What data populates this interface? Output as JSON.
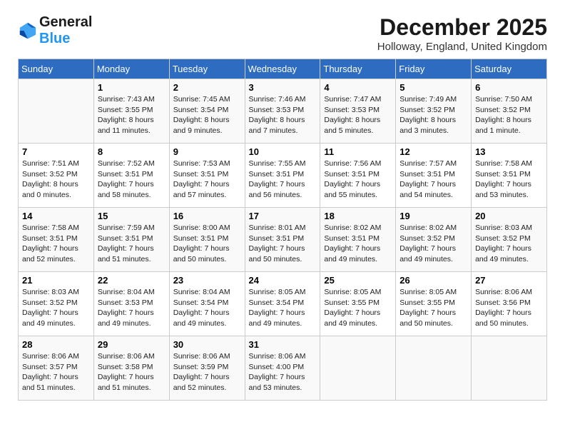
{
  "header": {
    "logo_general": "General",
    "logo_blue": "Blue",
    "month_year": "December 2025",
    "location": "Holloway, England, United Kingdom"
  },
  "weekdays": [
    "Sunday",
    "Monday",
    "Tuesday",
    "Wednesday",
    "Thursday",
    "Friday",
    "Saturday"
  ],
  "weeks": [
    [
      {
        "day": "",
        "info": ""
      },
      {
        "day": "1",
        "info": "Sunrise: 7:43 AM\nSunset: 3:55 PM\nDaylight: 8 hours\nand 11 minutes."
      },
      {
        "day": "2",
        "info": "Sunrise: 7:45 AM\nSunset: 3:54 PM\nDaylight: 8 hours\nand 9 minutes."
      },
      {
        "day": "3",
        "info": "Sunrise: 7:46 AM\nSunset: 3:53 PM\nDaylight: 8 hours\nand 7 minutes."
      },
      {
        "day": "4",
        "info": "Sunrise: 7:47 AM\nSunset: 3:53 PM\nDaylight: 8 hours\nand 5 minutes."
      },
      {
        "day": "5",
        "info": "Sunrise: 7:49 AM\nSunset: 3:52 PM\nDaylight: 8 hours\nand 3 minutes."
      },
      {
        "day": "6",
        "info": "Sunrise: 7:50 AM\nSunset: 3:52 PM\nDaylight: 8 hours\nand 1 minute."
      }
    ],
    [
      {
        "day": "7",
        "info": "Sunrise: 7:51 AM\nSunset: 3:52 PM\nDaylight: 8 hours\nand 0 minutes."
      },
      {
        "day": "8",
        "info": "Sunrise: 7:52 AM\nSunset: 3:51 PM\nDaylight: 7 hours\nand 58 minutes."
      },
      {
        "day": "9",
        "info": "Sunrise: 7:53 AM\nSunset: 3:51 PM\nDaylight: 7 hours\nand 57 minutes."
      },
      {
        "day": "10",
        "info": "Sunrise: 7:55 AM\nSunset: 3:51 PM\nDaylight: 7 hours\nand 56 minutes."
      },
      {
        "day": "11",
        "info": "Sunrise: 7:56 AM\nSunset: 3:51 PM\nDaylight: 7 hours\nand 55 minutes."
      },
      {
        "day": "12",
        "info": "Sunrise: 7:57 AM\nSunset: 3:51 PM\nDaylight: 7 hours\nand 54 minutes."
      },
      {
        "day": "13",
        "info": "Sunrise: 7:58 AM\nSunset: 3:51 PM\nDaylight: 7 hours\nand 53 minutes."
      }
    ],
    [
      {
        "day": "14",
        "info": "Sunrise: 7:58 AM\nSunset: 3:51 PM\nDaylight: 7 hours\nand 52 minutes."
      },
      {
        "day": "15",
        "info": "Sunrise: 7:59 AM\nSunset: 3:51 PM\nDaylight: 7 hours\nand 51 minutes."
      },
      {
        "day": "16",
        "info": "Sunrise: 8:00 AM\nSunset: 3:51 PM\nDaylight: 7 hours\nand 50 minutes."
      },
      {
        "day": "17",
        "info": "Sunrise: 8:01 AM\nSunset: 3:51 PM\nDaylight: 7 hours\nand 50 minutes."
      },
      {
        "day": "18",
        "info": "Sunrise: 8:02 AM\nSunset: 3:51 PM\nDaylight: 7 hours\nand 49 minutes."
      },
      {
        "day": "19",
        "info": "Sunrise: 8:02 AM\nSunset: 3:52 PM\nDaylight: 7 hours\nand 49 minutes."
      },
      {
        "day": "20",
        "info": "Sunrise: 8:03 AM\nSunset: 3:52 PM\nDaylight: 7 hours\nand 49 minutes."
      }
    ],
    [
      {
        "day": "21",
        "info": "Sunrise: 8:03 AM\nSunset: 3:52 PM\nDaylight: 7 hours\nand 49 minutes."
      },
      {
        "day": "22",
        "info": "Sunrise: 8:04 AM\nSunset: 3:53 PM\nDaylight: 7 hours\nand 49 minutes."
      },
      {
        "day": "23",
        "info": "Sunrise: 8:04 AM\nSunset: 3:54 PM\nDaylight: 7 hours\nand 49 minutes."
      },
      {
        "day": "24",
        "info": "Sunrise: 8:05 AM\nSunset: 3:54 PM\nDaylight: 7 hours\nand 49 minutes."
      },
      {
        "day": "25",
        "info": "Sunrise: 8:05 AM\nSunset: 3:55 PM\nDaylight: 7 hours\nand 49 minutes."
      },
      {
        "day": "26",
        "info": "Sunrise: 8:05 AM\nSunset: 3:55 PM\nDaylight: 7 hours\nand 50 minutes."
      },
      {
        "day": "27",
        "info": "Sunrise: 8:06 AM\nSunset: 3:56 PM\nDaylight: 7 hours\nand 50 minutes."
      }
    ],
    [
      {
        "day": "28",
        "info": "Sunrise: 8:06 AM\nSunset: 3:57 PM\nDaylight: 7 hours\nand 51 minutes."
      },
      {
        "day": "29",
        "info": "Sunrise: 8:06 AM\nSunset: 3:58 PM\nDaylight: 7 hours\nand 51 minutes."
      },
      {
        "day": "30",
        "info": "Sunrise: 8:06 AM\nSunset: 3:59 PM\nDaylight: 7 hours\nand 52 minutes."
      },
      {
        "day": "31",
        "info": "Sunrise: 8:06 AM\nSunset: 4:00 PM\nDaylight: 7 hours\nand 53 minutes."
      },
      {
        "day": "",
        "info": ""
      },
      {
        "day": "",
        "info": ""
      },
      {
        "day": "",
        "info": ""
      }
    ]
  ]
}
